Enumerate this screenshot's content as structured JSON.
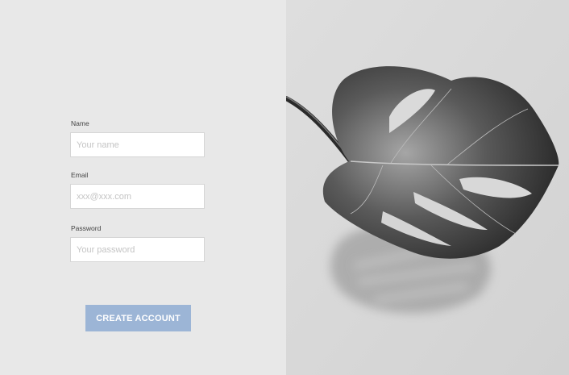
{
  "form": {
    "name": {
      "label": "Name",
      "placeholder": "Your name"
    },
    "email": {
      "label": "Email",
      "placeholder": "xxx@xxx.com"
    },
    "password": {
      "label": "Password",
      "placeholder": "Your password"
    },
    "submit_label": "CREATE ACCOUNT"
  },
  "photo": {
    "subject": "monstera-leaf-photo",
    "tone": "black-and-white"
  },
  "colors": {
    "page_background": "#e8e8e8",
    "button_background": "#9cb5d6",
    "button_text": "#ffffff",
    "input_border": "#d6d6d6",
    "placeholder_text": "#c4c4c4"
  }
}
